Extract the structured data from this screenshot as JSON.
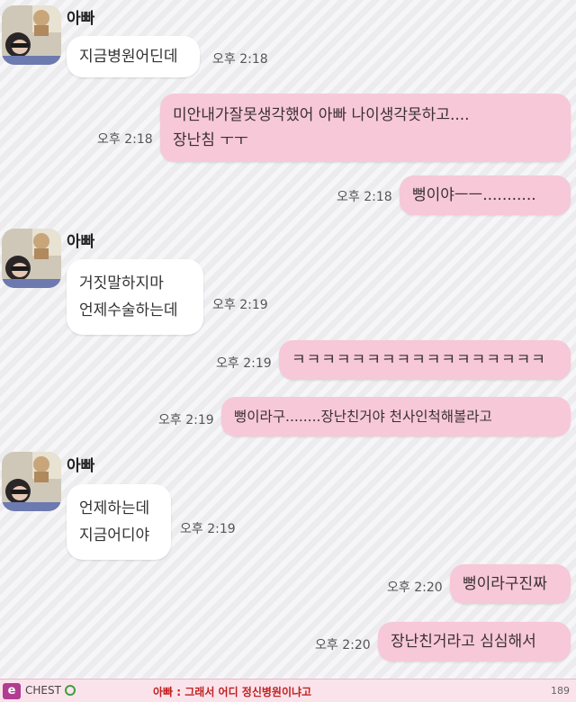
{
  "conversation": {
    "sender_name": "아빠",
    "messages": [
      {
        "dir": "in",
        "lines": [
          "지금병원어딘데"
        ],
        "time": "오후 2:18"
      },
      {
        "dir": "out",
        "lines": [
          "미안내가잘못생각했어 아빠 나이생각못하고....",
          "장난침 ㅜㅜ"
        ],
        "time": "오후 2:18"
      },
      {
        "dir": "out",
        "lines": [
          "뻥이야ㅡㅡ..........."
        ],
        "time": "오후 2:18"
      },
      {
        "dir": "in",
        "lines": [
          "거짓말하지마",
          "언제수술하는데"
        ],
        "time": "오후 2:19"
      },
      {
        "dir": "out",
        "lines": [
          "ㅋㅋㅋㅋㅋㅋㅋㅋㅋㅋㅋㅋㅋㅋㅋㅋㅋ"
        ],
        "time": "오후 2:19"
      },
      {
        "dir": "out",
        "lines": [
          "뻥이라구........장난친거야 천사인척해볼라고"
        ],
        "time": "오후 2:19"
      },
      {
        "dir": "in",
        "lines": [
          "언제하는데",
          "지금어디야"
        ],
        "time": "오후 2:19"
      },
      {
        "dir": "out",
        "lines": [
          "뻥이라구진짜"
        ],
        "time": "오후 2:20"
      },
      {
        "dir": "out",
        "lines": [
          "장난친거라고 심심해서"
        ],
        "time": "오후 2:20"
      }
    ]
  },
  "bottom_bar": {
    "logo_letter": "e",
    "brand": "CHEST",
    "ticker": "아빠 : 그래서 어디 정신병원이냐고",
    "page_count": "189"
  },
  "colors": {
    "incoming_bubble": "#ffffff",
    "outgoing_bubble": "#f7c8d7",
    "background": "#ececef",
    "ticker_text": "#c0211f"
  },
  "icons": {
    "avatar": "profile-photo",
    "brand_icon": "green-circle-icon"
  }
}
